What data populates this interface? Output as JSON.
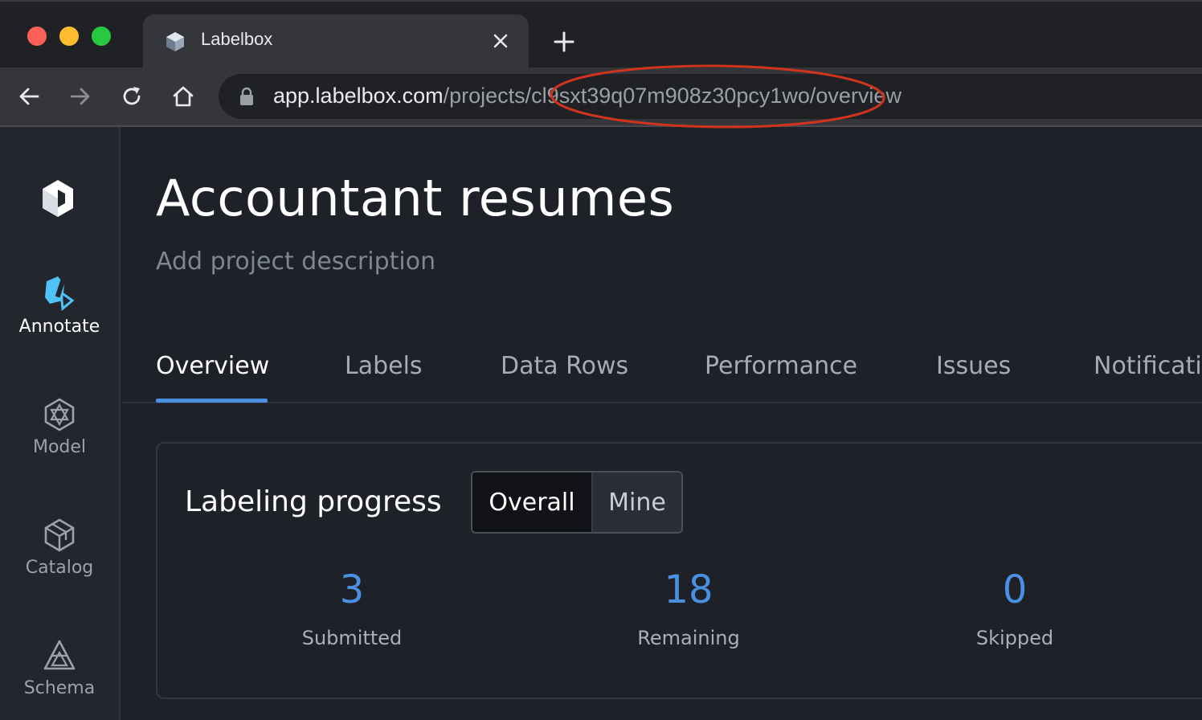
{
  "browser": {
    "tab_title": "Labelbox",
    "url_host": "app.labelbox.com",
    "url_path": "/projects/cl9sxt39q07m908z30pcy1wo",
    "url_tail": "/overview"
  },
  "sidebar": {
    "items": [
      {
        "label": "Annotate",
        "icon": "annotate-icon",
        "active": true
      },
      {
        "label": "Model",
        "icon": "model-icon"
      },
      {
        "label": "Catalog",
        "icon": "catalog-icon"
      },
      {
        "label": "Schema",
        "icon": "schema-icon"
      }
    ]
  },
  "project": {
    "title": "Accountant resumes",
    "description_placeholder": "Add project description"
  },
  "tabs": [
    {
      "label": "Overview",
      "active": true
    },
    {
      "label": "Labels"
    },
    {
      "label": "Data Rows"
    },
    {
      "label": "Performance"
    },
    {
      "label": "Issues"
    },
    {
      "label": "Notificati"
    }
  ],
  "progress": {
    "title": "Labeling progress",
    "toggle": {
      "overall": "Overall",
      "mine": "Mine",
      "selected": "Overall"
    },
    "stats": [
      {
        "value": "3",
        "label": "Submitted"
      },
      {
        "value": "18",
        "label": "Remaining"
      },
      {
        "value": "0",
        "label": "Skipped"
      }
    ]
  },
  "colors": {
    "accent": "#4a90e2",
    "annotation_circle": "#d2331f",
    "annotate_icon": "#4fc3f7"
  }
}
